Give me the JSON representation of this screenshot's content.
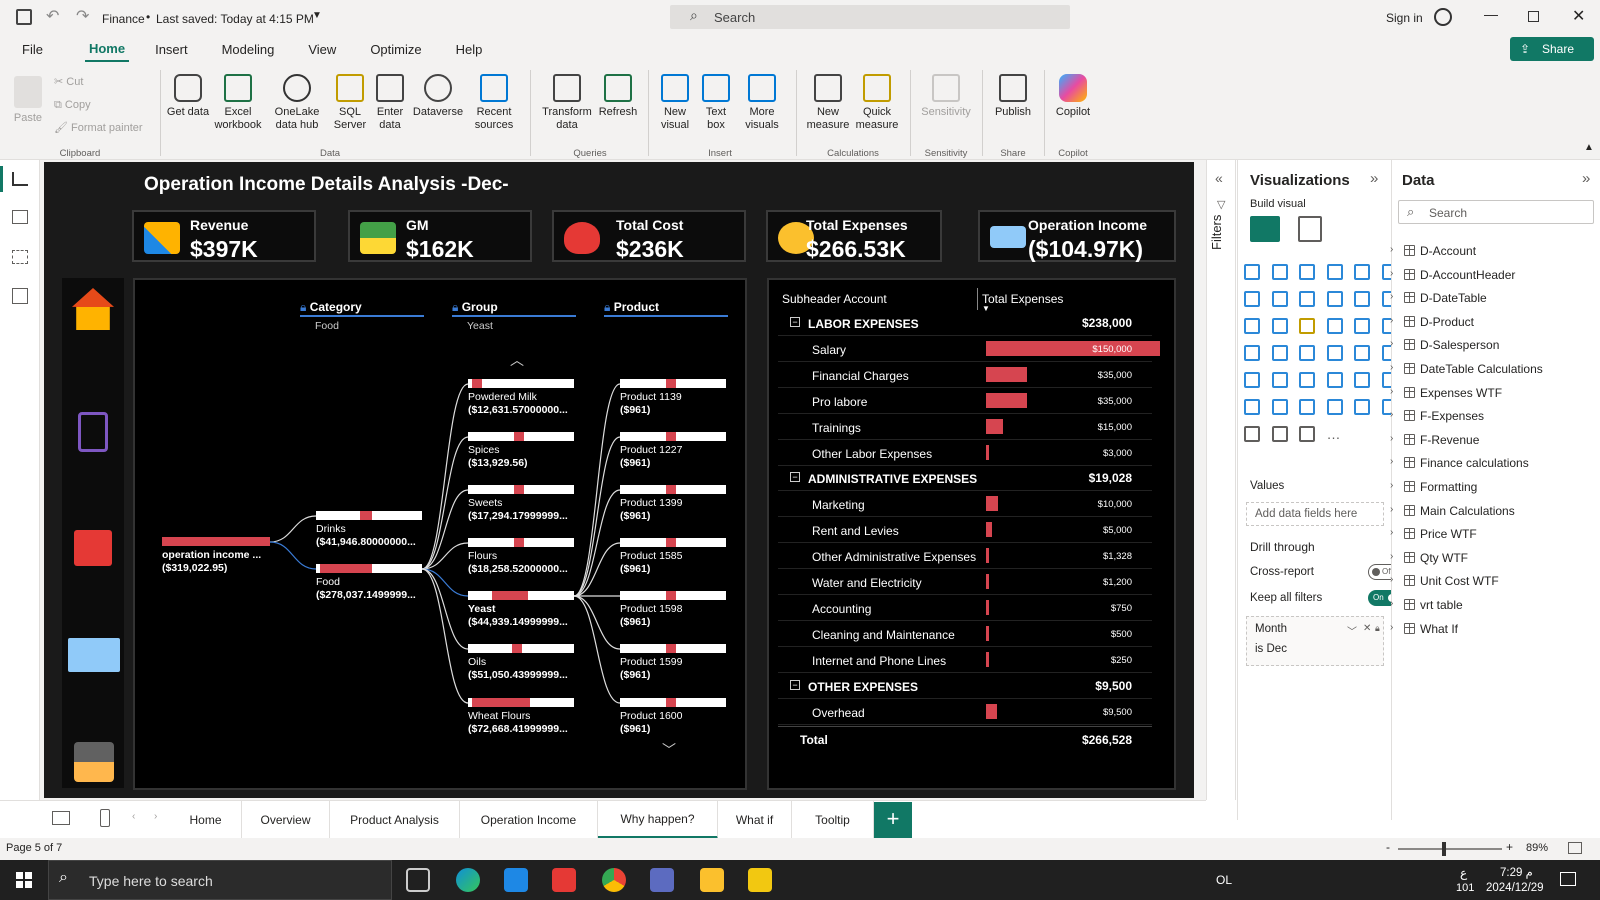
{
  "titlebar": {
    "app_title": "Finance",
    "saved_status": "Last saved: Today at 4:15 PM",
    "search_placeholder": "Search",
    "sign_in": "Sign in"
  },
  "ribbon": {
    "tabs": [
      "File",
      "Home",
      "Insert",
      "Modeling",
      "View",
      "Optimize",
      "Help"
    ],
    "active_tab": "Home",
    "share_label": "Share",
    "clipboard": {
      "paste": "Paste",
      "cut": "Cut",
      "copy": "Copy",
      "format_painter": "Format painter",
      "group": "Clipboard"
    },
    "data": {
      "get_data": "Get data",
      "excel": "Excel workbook",
      "onelake": "OneLake data hub",
      "sql": "SQL Server",
      "enter": "Enter data",
      "dataverse": "Dataverse",
      "recent": "Recent sources",
      "group": "Data"
    },
    "queries": {
      "transform": "Transform data",
      "refresh": "Refresh",
      "group": "Queries"
    },
    "insert": {
      "new_visual": "New visual",
      "text_box": "Text box",
      "more_visuals": "More visuals",
      "group": "Insert"
    },
    "calculations": {
      "new_measure": "New measure",
      "quick_measure": "Quick measure",
      "group": "Calculations"
    },
    "sensitivity": {
      "label": "Sensitivity",
      "group": "Sensitivity"
    },
    "share": {
      "publish": "Publish",
      "group": "Share"
    },
    "copilot": {
      "label": "Copilot",
      "group": "Copilot"
    }
  },
  "report": {
    "title": "Operation Income Details Analysis -Dec-",
    "kpis": [
      {
        "title": "Revenue",
        "value": "$397K"
      },
      {
        "title": "GM",
        "value": "$162K"
      },
      {
        "title": "Total Cost",
        "value": "$236K"
      },
      {
        "title": "Total Expenses",
        "value": "$266.53K"
      },
      {
        "title": "Operation Income",
        "value": "($104.97K)"
      }
    ],
    "tree": {
      "levels": [
        {
          "name": "Category",
          "selected": "Food"
        },
        {
          "name": "Group",
          "selected": "Yeast"
        },
        {
          "name": "Product",
          "selected": ""
        }
      ],
      "root": {
        "label": "operation income ...",
        "value": "($319,022.95)"
      },
      "category": [
        {
          "label": "Drinks",
          "value": "($41,946.80000000..."
        },
        {
          "label": "Food",
          "value": "($278,037.1499999..."
        }
      ],
      "group": [
        {
          "label": "Powdered Milk",
          "value": "($12,631.57000000..."
        },
        {
          "label": "Spices",
          "value": "($13,929.56)"
        },
        {
          "label": "Sweets",
          "value": "($17,294.17999999..."
        },
        {
          "label": "Flours",
          "value": "($18,258.52000000..."
        },
        {
          "label": "Yeast",
          "value": "($44,939.14999999..."
        },
        {
          "label": "Oils",
          "value": "($51,050.43999999..."
        },
        {
          "label": "Wheat Flours",
          "value": "($72,668.41999999..."
        }
      ],
      "product": [
        {
          "label": "Product 1139",
          "value": "($961)"
        },
        {
          "label": "Product 1227",
          "value": "($961)"
        },
        {
          "label": "Product 1399",
          "value": "($961)"
        },
        {
          "label": "Product 1585",
          "value": "($961)"
        },
        {
          "label": "Product 1598",
          "value": "($961)"
        },
        {
          "label": "Product 1599",
          "value": "($961)"
        },
        {
          "label": "Product 1600",
          "value": "($961)"
        }
      ]
    },
    "matrix": {
      "col1": "Subheader Account",
      "col2": "Total Expenses",
      "rows": [
        {
          "type": "header",
          "name": "LABOR EXPENSES",
          "value": "$238,000",
          "amount": 238000
        },
        {
          "type": "item",
          "name": "Salary",
          "value": "$150,000",
          "amount": 150000
        },
        {
          "type": "item",
          "name": "Financial Charges",
          "value": "$35,000",
          "amount": 35000
        },
        {
          "type": "item",
          "name": "Pro labore",
          "value": "$35,000",
          "amount": 35000
        },
        {
          "type": "item",
          "name": "Trainings",
          "value": "$15,000",
          "amount": 15000
        },
        {
          "type": "item",
          "name": "Other Labor Expenses",
          "value": "$3,000",
          "amount": 3000
        },
        {
          "type": "header",
          "name": "ADMINISTRATIVE EXPENSES",
          "value": "$19,028",
          "amount": 19028
        },
        {
          "type": "item",
          "name": "Marketing",
          "value": "$10,000",
          "amount": 10000
        },
        {
          "type": "item",
          "name": "Rent and Levies",
          "value": "$5,000",
          "amount": 5000
        },
        {
          "type": "item",
          "name": "Other Administrative Expenses",
          "value": "$1,328",
          "amount": 1328
        },
        {
          "type": "item",
          "name": "Water and Electricity",
          "value": "$1,200",
          "amount": 1200
        },
        {
          "type": "item",
          "name": "Accounting",
          "value": "$750",
          "amount": 750
        },
        {
          "type": "item",
          "name": "Cleaning and Maintenance",
          "value": "$500",
          "amount": 500
        },
        {
          "type": "item",
          "name": "Internet and Phone Lines",
          "value": "$250",
          "amount": 250
        },
        {
          "type": "header",
          "name": "OTHER EXPENSES",
          "value": "$9,500",
          "amount": 9500
        },
        {
          "type": "item",
          "name": "Overhead",
          "value": "$9,500",
          "amount": 9500
        }
      ],
      "total_label": "Total",
      "total_value": "$266,528",
      "max_amount": 150000
    }
  },
  "filters_label": "Filters",
  "visualizations": {
    "title": "Visualizations",
    "build_visual": "Build visual",
    "values_label": "Values",
    "add_fields": "Add data fields here",
    "drill_through": "Drill through",
    "cross_report": "Cross-report",
    "cross_report_state": "Off",
    "keep_filters": "Keep all filters",
    "keep_filters_state": "On",
    "filter_field": "Month",
    "filter_value": "is Dec"
  },
  "data_pane": {
    "title": "Data",
    "search_placeholder": "Search",
    "tables": [
      "D-Account",
      "D-AccountHeader",
      "D-DateTable",
      "D-Product",
      "D-Salesperson",
      "DateTable Calculations",
      "Expenses WTF",
      "F-Expenses",
      "F-Revenue",
      "Finance calculations",
      "Formatting",
      "Main Calculations",
      "Price WTF",
      "Qty WTF",
      "Unit Cost WTF",
      "vrt table",
      "What If"
    ]
  },
  "pages": [
    "Home",
    "Overview",
    "Product Analysis",
    "Operation Income",
    "Why happen?",
    "What if",
    "Tooltip"
  ],
  "active_page": "Why happen?",
  "status": {
    "page": "Page 5 of 7",
    "zoom": "89%"
  },
  "taskbar": {
    "search_placeholder": "Type here to search",
    "time": "7:29 م",
    "date": "2024/12/29",
    "lang": "OL",
    "kb": "ع",
    "num": "101"
  },
  "colors": {
    "accent": "#117865",
    "bar": "#d64550",
    "report_bg": "#1a1a1a"
  }
}
